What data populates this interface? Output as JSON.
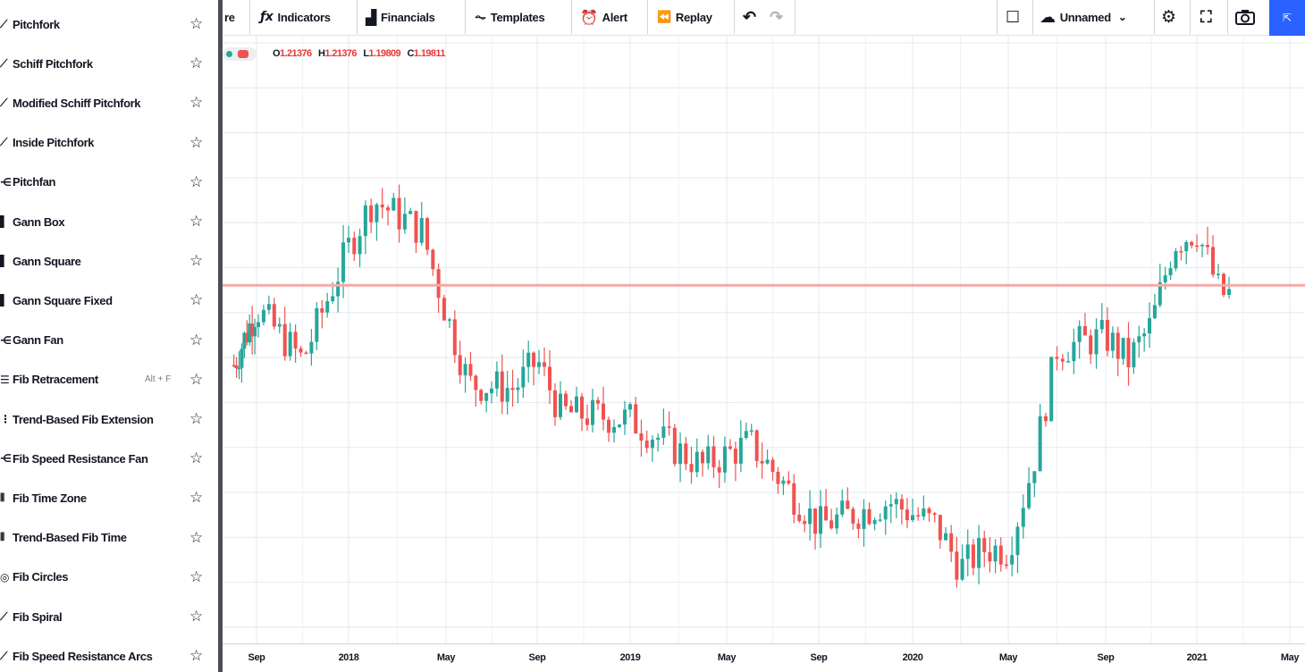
{
  "sidebar": {
    "items": [
      {
        "label": "Pitchfork",
        "glyph": "⟋",
        "hotkey": ""
      },
      {
        "label": "Schiff Pitchfork",
        "glyph": "⟋",
        "hotkey": ""
      },
      {
        "label": "Modified Schiff Pitchfork",
        "glyph": "⟋",
        "hotkey": ""
      },
      {
        "label": "Inside Pitchfork",
        "glyph": "⟋",
        "hotkey": ""
      },
      {
        "label": "Pitchfan",
        "glyph": "⋲",
        "hotkey": ""
      },
      {
        "label": "Gann Box",
        "glyph": "▌",
        "hotkey": ""
      },
      {
        "label": "Gann Square",
        "glyph": "▌",
        "hotkey": ""
      },
      {
        "label": "Gann Square Fixed",
        "glyph": "▌",
        "hotkey": ""
      },
      {
        "label": "Gann Fan",
        "glyph": "⋲",
        "hotkey": ""
      },
      {
        "label": "Fib Retracement",
        "glyph": "☰",
        "hotkey": "Alt + F"
      },
      {
        "label": "Trend-Based Fib Extension",
        "glyph": "⋮",
        "hotkey": ""
      },
      {
        "label": "Fib Speed Resistance Fan",
        "glyph": "⋲",
        "hotkey": ""
      },
      {
        "label": "Fib Time Zone",
        "glyph": "⦀",
        "hotkey": ""
      },
      {
        "label": "Trend-Based Fib Time",
        "glyph": "⦀",
        "hotkey": ""
      },
      {
        "label": "Fib Circles",
        "glyph": "◎",
        "hotkey": ""
      },
      {
        "label": "Fib Spiral",
        "glyph": "⟋",
        "hotkey": ""
      },
      {
        "label": "Fib Speed Resistance Arcs",
        "glyph": "⟋",
        "hotkey": ""
      }
    ],
    "star_glyph": "☆"
  },
  "toolbar": {
    "compare_partial": "re",
    "indicators_label": "Indicators",
    "financials_label": "Financials",
    "templates_label": "Templates",
    "alert_label": "Alert",
    "replay_label": "Replay",
    "undo_glyph": "↶",
    "redo_glyph": "↷",
    "layout_name": "Unnamed",
    "indicators_icon": "ƒx",
    "financials_icon": "▟",
    "templates_icon": "⏦",
    "alert_icon": "⏰",
    "replay_icon": "⏪",
    "layout_icon": "☐",
    "cloud_icon": "☁",
    "caret_icon": "⌄",
    "settings_icon": "⚙",
    "fullscreen_icon": "⛶",
    "camera_icon": "📷",
    "publish_icon": "⇱"
  },
  "legend": {
    "o_key": "O",
    "o_val": "1.21376",
    "h_key": "H",
    "h_val": "1.21376",
    "l_key": "L",
    "l_val": "1.19809",
    "c_key": "C",
    "c_val": "1.19811"
  },
  "time_axis": {
    "labels": [
      "Sep",
      "2018",
      "May",
      "Sep",
      "2019",
      "May",
      "Sep",
      "2020",
      "May",
      "Sep",
      "2021",
      "May"
    ]
  },
  "chart_data": {
    "type": "candlestick",
    "interval": "weekly",
    "x_ticks": [
      "Sep",
      "2018",
      "May",
      "Sep",
      "2019",
      "May",
      "Sep",
      "2020",
      "May",
      "Sep",
      "2021",
      "May"
    ],
    "price_line": {
      "value": 1.2018,
      "color": "#f7a9a7"
    },
    "last_bar": {
      "open": 1.21376,
      "high": 1.21376,
      "low": 1.19809,
      "close": 1.19811
    },
    "ylim": [
      1.05,
      1.3
    ],
    "close_path": [
      {
        "x": "2017-07",
        "close": 1.168
      },
      {
        "x": "2017-09",
        "close": 1.192
      },
      {
        "x": "2017-11",
        "close": 1.17
      },
      {
        "x": "2018-01",
        "close": 1.218
      },
      {
        "x": "2018-02",
        "close": 1.238
      },
      {
        "x": "2018-04",
        "close": 1.225
      },
      {
        "x": "2018-05",
        "close": 1.19
      },
      {
        "x": "2018-06",
        "close": 1.16
      },
      {
        "x": "2018-08",
        "close": 1.158
      },
      {
        "x": "2018-09",
        "close": 1.17
      },
      {
        "x": "2018-10",
        "close": 1.148
      },
      {
        "x": "2019-01",
        "close": 1.145
      },
      {
        "x": "2019-04",
        "close": 1.125
      },
      {
        "x": "2019-06",
        "close": 1.135
      },
      {
        "x": "2019-09",
        "close": 1.1
      },
      {
        "x": "2019-12",
        "close": 1.11
      },
      {
        "x": "2020-02",
        "close": 1.1
      },
      {
        "x": "2020-03",
        "close": 1.082
      },
      {
        "x": "2020-04",
        "close": 1.09
      },
      {
        "x": "2020-05",
        "close": 1.09
      },
      {
        "x": "2020-06",
        "close": 1.125
      },
      {
        "x": "2020-07",
        "close": 1.175
      },
      {
        "x": "2020-09",
        "close": 1.18
      },
      {
        "x": "2020-10",
        "close": 1.17
      },
      {
        "x": "2020-11",
        "close": 1.185
      },
      {
        "x": "2020-12",
        "close": 1.22
      },
      {
        "x": "2021-01",
        "close": 1.225
      },
      {
        "x": "2021-02",
        "close": 1.198
      }
    ]
  }
}
